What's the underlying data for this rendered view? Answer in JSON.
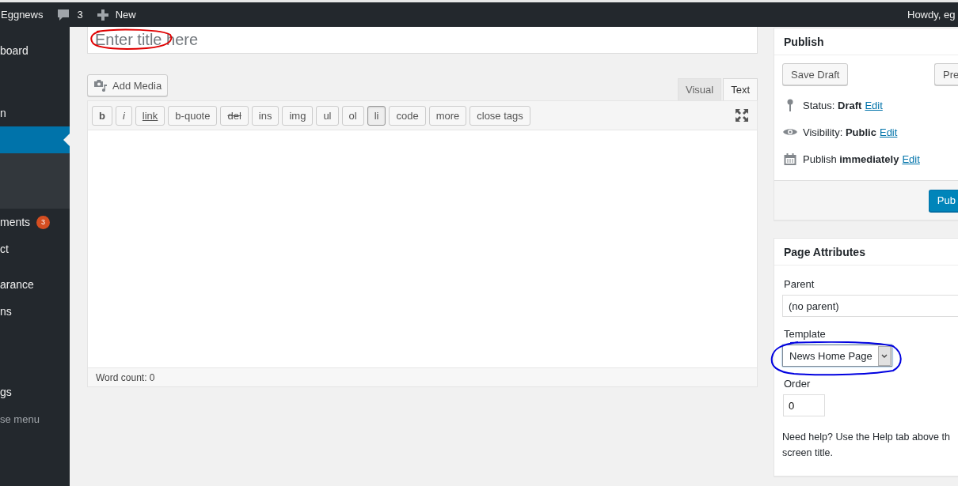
{
  "admin_bar": {
    "site": "Eggnews",
    "comments": "3",
    "new": "New",
    "greeting": "Howdy, eg"
  },
  "sidebar": {
    "items": [
      {
        "label": "board",
        "selected": false
      },
      {
        "label": "n",
        "selected": false
      },
      {
        "selected": true
      },
      {
        "label": "ments",
        "selected": false,
        "badge": "3"
      },
      {
        "label": "ct",
        "selected": false
      },
      {
        "label": "arance",
        "selected": false
      },
      {
        "label": "ns",
        "selected": false
      },
      {
        "label": "gs",
        "selected": false
      },
      {
        "label": "se menu",
        "selected": false,
        "kind": "collapse"
      }
    ]
  },
  "editor": {
    "title_placeholder": "Enter title here",
    "add_media": "Add Media",
    "tabs": [
      {
        "label": "Visual",
        "selected": false
      },
      {
        "label": "Text",
        "selected": true
      }
    ],
    "toolbar": [
      {
        "label": "b",
        "kind": "bold"
      },
      {
        "label": "i",
        "kind": "italic"
      },
      {
        "label": "link",
        "kind": "underline"
      },
      {
        "label": "b-quote",
        "kind": "plain"
      },
      {
        "label": "del",
        "kind": "strike"
      },
      {
        "label": "ins",
        "kind": "plain"
      },
      {
        "label": "img",
        "kind": "plain"
      },
      {
        "label": "ul",
        "kind": "plain"
      },
      {
        "label": "ol",
        "kind": "plain"
      },
      {
        "label": "li",
        "kind": "active"
      },
      {
        "label": "code",
        "kind": "plain"
      },
      {
        "label": "more",
        "kind": "plain"
      },
      {
        "label": "close tags",
        "kind": "plain"
      }
    ],
    "word_count": "Word count: 0"
  },
  "publish": {
    "title": "Publish",
    "save_draft": "Save Draft",
    "preview": "Pre",
    "rows": [
      {
        "kind": "pin",
        "label": "Status: ",
        "value": "Draft",
        "link": "Edit"
      },
      {
        "kind": "eye",
        "label": "Visibility: ",
        "value": "Public",
        "link": "Edit"
      },
      {
        "kind": "calendar",
        "label": "Publish ",
        "value": "immediately",
        "link": "Edit"
      }
    ],
    "publish_button": "Pub"
  },
  "page_attributes": {
    "title": "Page Attributes",
    "parent_label": "Parent",
    "parent_value": "(no parent)",
    "template_label": "Template",
    "template_value": "News Home Page",
    "order_label": "Order",
    "order_value": "0",
    "help": [
      "Need help? Use the Help tab above th",
      "screen title."
    ]
  },
  "annotations": [
    {
      "kind": "title",
      "color": "#e00000"
    },
    {
      "kind": "template",
      "color": "#0000e0"
    }
  ]
}
